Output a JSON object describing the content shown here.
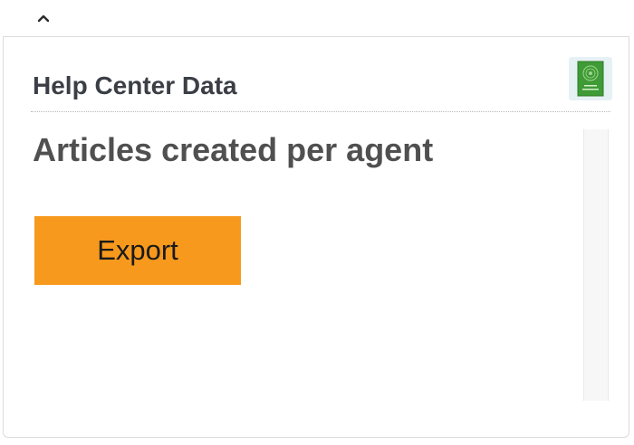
{
  "toolbar": {
    "collapse_icon": "chevron-up-icon"
  },
  "card": {
    "title": "Help Center Data",
    "logo": {
      "icon": "zendesk-app-logo-icon",
      "background_color": "#e6f1f4",
      "tile_color": "#3f9b35"
    }
  },
  "report": {
    "title": "Articles created per agent",
    "export_label": "Export",
    "export_color": "#f7991d"
  }
}
